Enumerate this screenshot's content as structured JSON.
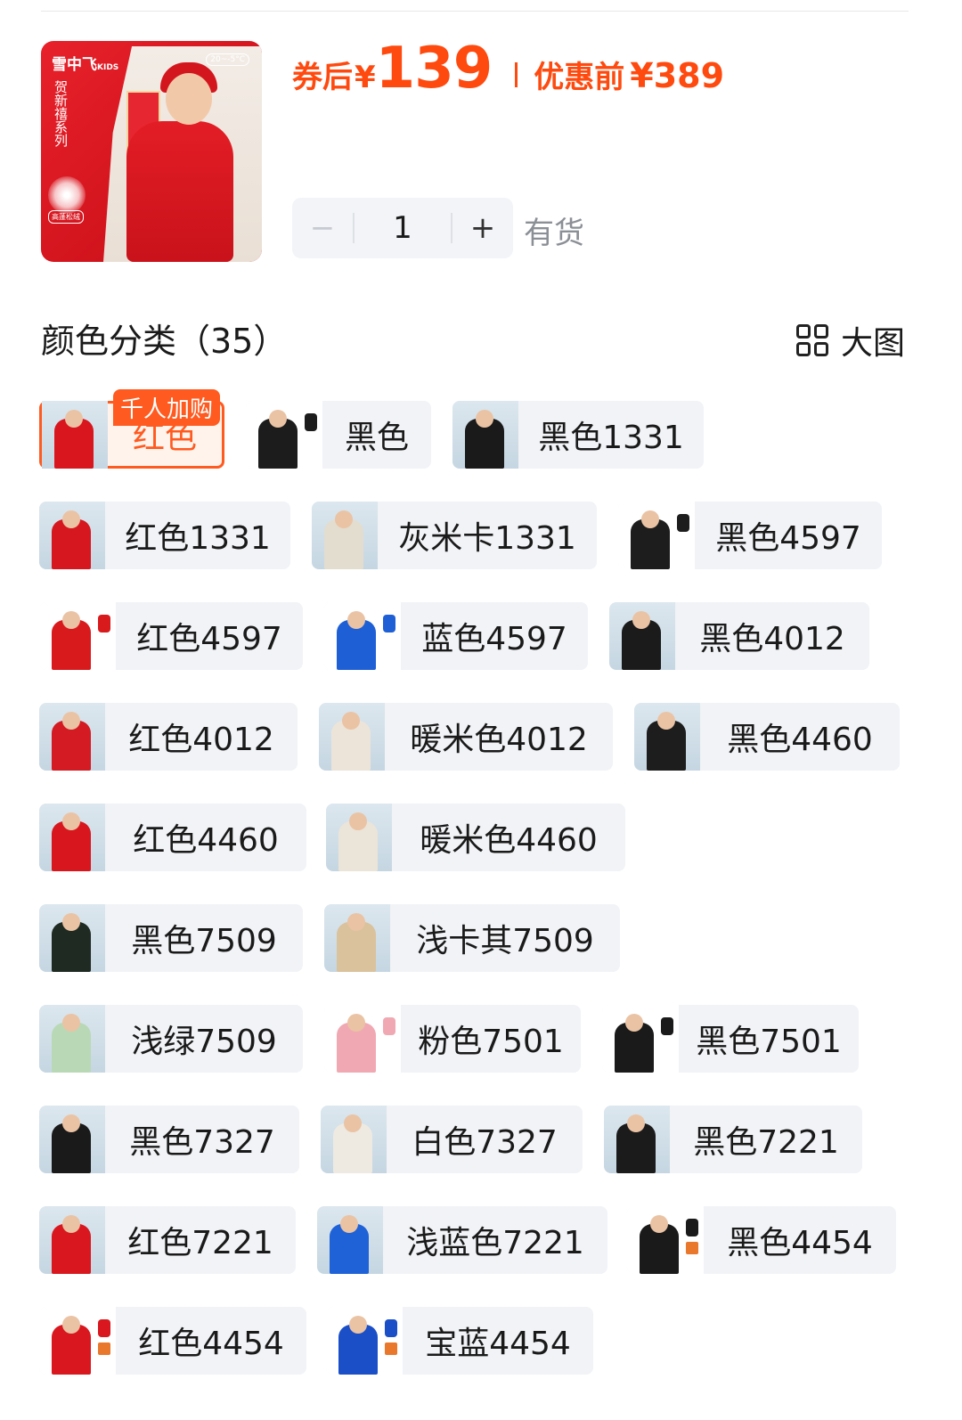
{
  "product": {
    "thumb_brand": "雪中飞",
    "thumb_brand_sub": "KIDS",
    "thumb_temp": "20~-5°C",
    "thumb_series": "贺新禧系列",
    "thumb_tag": "高蓬松绒"
  },
  "price": {
    "after_coupon_label": "券后",
    "currency": "¥",
    "value": "139",
    "original_label": "优惠前",
    "original_value": "¥389",
    "accent_color": "#ff4a0f"
  },
  "quantity": {
    "minus_icon": "−",
    "value": "1",
    "plus_icon": "+",
    "stock_status": "有货"
  },
  "colors": {
    "section_title": "颜色分类（35）",
    "view_label": "大图",
    "selected_badge": "千人加购",
    "options": [
      {
        "label": "红色",
        "coat": "#d9151e",
        "selected": true
      },
      {
        "label": "黑色",
        "coat": "#1c1c1c"
      },
      {
        "label": "黑色1331",
        "coat": "#1a1a1a"
      },
      {
        "label": "红色1331",
        "coat": "#d6171f"
      },
      {
        "label": "灰米卡1331",
        "coat": "#e3ddcf"
      },
      {
        "label": "黑色4597",
        "coat": "#1d1d1d"
      },
      {
        "label": "红色4597",
        "coat": "#d91a1d"
      },
      {
        "label": "蓝色4597",
        "coat": "#1f5fd6"
      },
      {
        "label": "黑色4012",
        "coat": "#1b1b1b"
      },
      {
        "label": "红色4012",
        "coat": "#d41a22"
      },
      {
        "label": "暖米色4012",
        "coat": "#ece4d8"
      },
      {
        "label": "黑色4460",
        "coat": "#1d1d1d"
      },
      {
        "label": "红色4460",
        "coat": "#d8161e"
      },
      {
        "label": "暖米色4460",
        "coat": "#ebe4d8"
      },
      {
        "label": "黑色7509",
        "coat": "#1f2a22"
      },
      {
        "label": "浅卡其7509",
        "coat": "#d9c29c"
      },
      {
        "label": "浅绿7509",
        "coat": "#b9d9b6"
      },
      {
        "label": "粉色7501",
        "coat": "#f0a9b3"
      },
      {
        "label": "黑色7501",
        "coat": "#1a1a1a"
      },
      {
        "label": "黑色7327",
        "coat": "#1a1a1a"
      },
      {
        "label": "白色7327",
        "coat": "#eeeae2"
      },
      {
        "label": "黑色7221",
        "coat": "#1b1b1b"
      },
      {
        "label": "红色7221",
        "coat": "#d8181e"
      },
      {
        "label": "浅蓝色7221",
        "coat": "#1f62d8"
      },
      {
        "label": "黑色4454",
        "coat": "#1a1a1a"
      },
      {
        "label": "红色4454",
        "coat": "#d8181e"
      },
      {
        "label": "宝蓝4454",
        "coat": "#1b4fc8"
      }
    ]
  }
}
